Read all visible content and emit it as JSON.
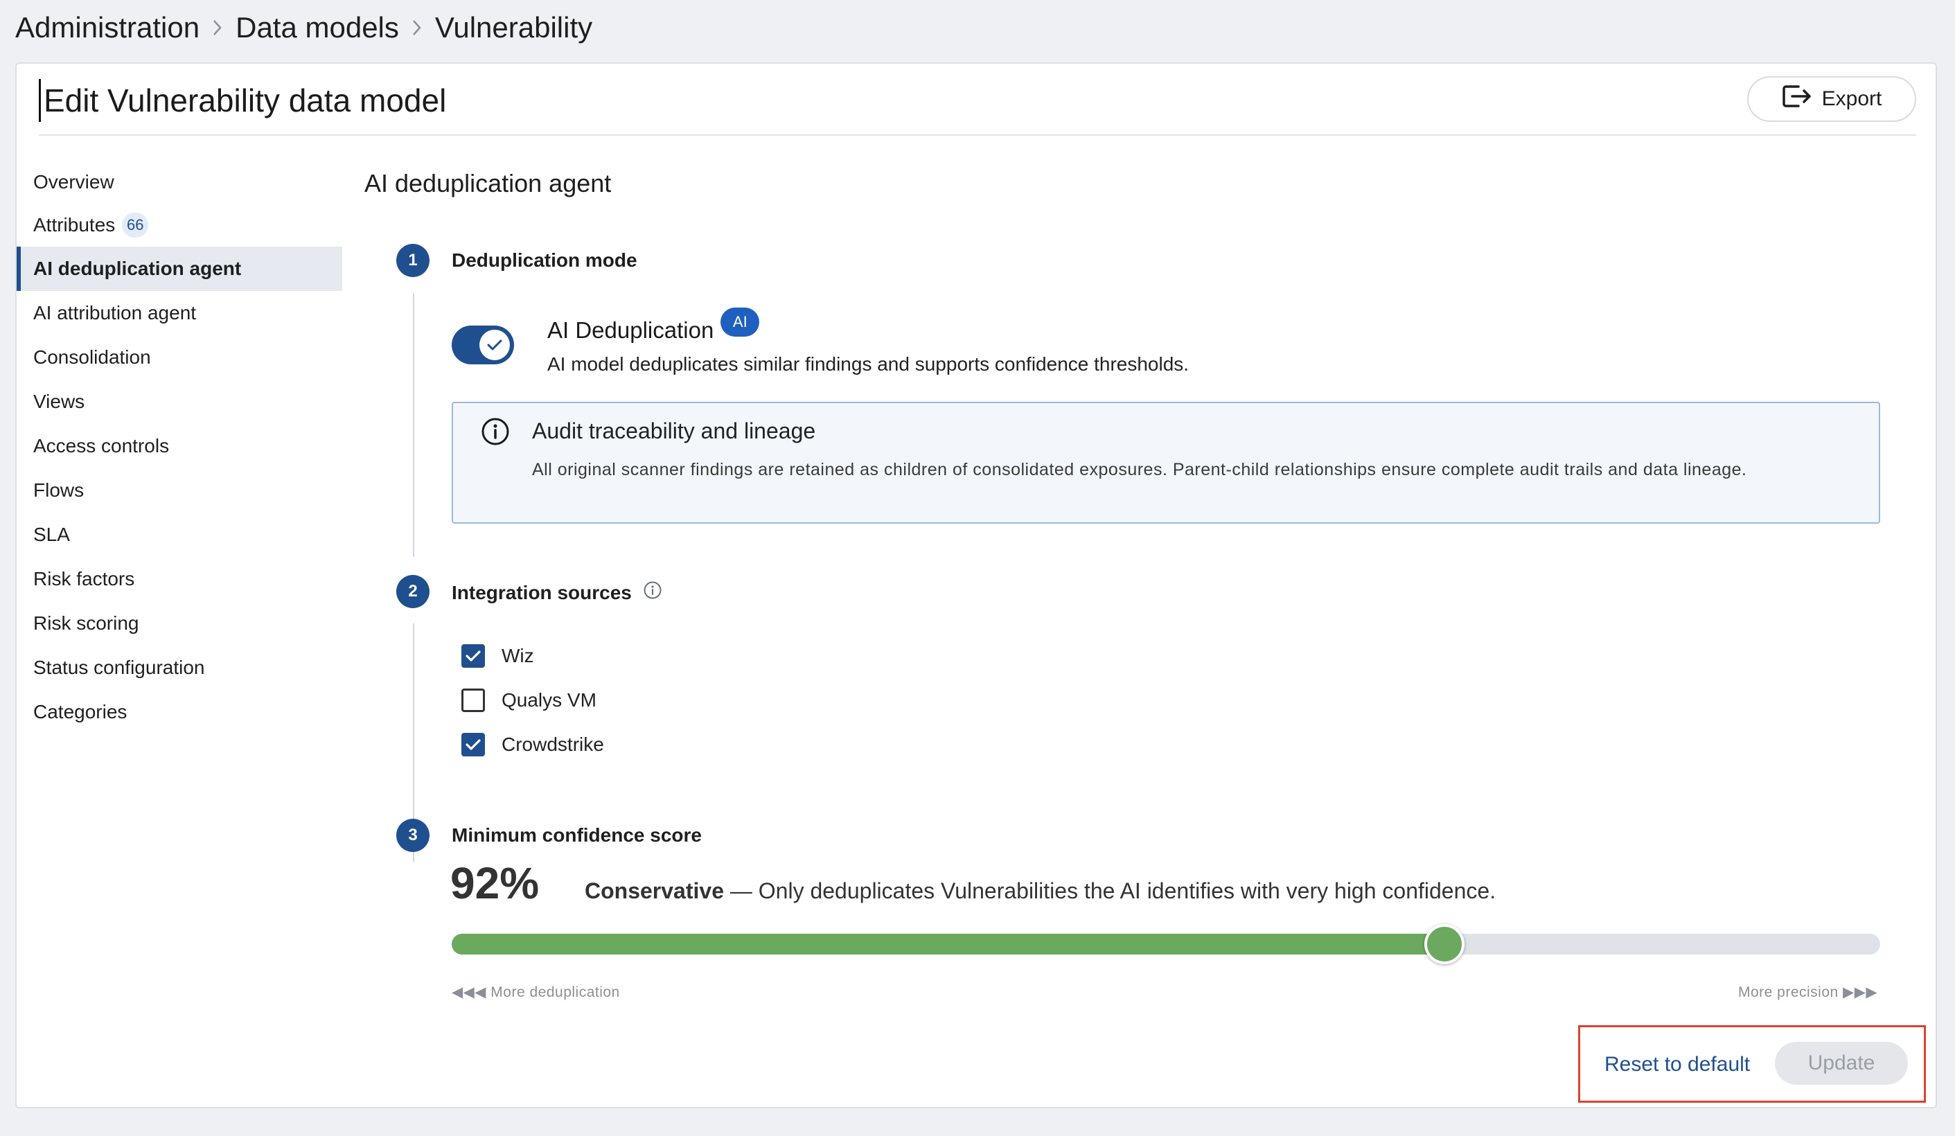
{
  "breadcrumb": [
    "Administration",
    "Data models",
    "Vulnerability"
  ],
  "header": {
    "title": "Edit Vulnerability data model",
    "export_label": "Export"
  },
  "sidebar": {
    "items": [
      {
        "label": "Overview"
      },
      {
        "label": "Attributes",
        "badge": "66"
      },
      {
        "label": "AI deduplication agent",
        "active": true
      },
      {
        "label": "AI attribution agent"
      },
      {
        "label": "Consolidation"
      },
      {
        "label": "Views"
      },
      {
        "label": "Access controls"
      },
      {
        "label": "Flows"
      },
      {
        "label": "SLA"
      },
      {
        "label": "Risk factors"
      },
      {
        "label": "Risk scoring"
      },
      {
        "label": "Status configuration"
      },
      {
        "label": "Categories"
      }
    ]
  },
  "main": {
    "section_title": "AI deduplication agent",
    "steps": [
      {
        "number": "1",
        "title": "Deduplication mode"
      },
      {
        "number": "2",
        "title": "Integration sources"
      },
      {
        "number": "3",
        "title": "Minimum confidence score"
      }
    ],
    "dedup": {
      "toggle_on": true,
      "title": "AI Deduplication",
      "badge": "AI",
      "description": "AI model deduplicates similar findings and supports confidence thresholds."
    },
    "info": {
      "title": "Audit traceability and lineage",
      "text": "All original scanner findings are retained as children of consolidated exposures. Parent-child relationships ensure complete audit trails and data lineage."
    },
    "sources": [
      {
        "label": "Wiz",
        "checked": true
      },
      {
        "label": "Qualys VM",
        "checked": false
      },
      {
        "label": "Crowdstrike",
        "checked": true
      }
    ],
    "confidence": {
      "value_label": "92%",
      "value": 92,
      "slider_fraction": 0.695,
      "mode": "Conservative",
      "mode_desc": " — Only deduplicates Vulnerabilities the AI identifies with very high confidence.",
      "left_hint": "More deduplication",
      "right_hint": "More precision"
    },
    "actions": {
      "reset_label": "Reset to default",
      "update_label": "Update"
    }
  },
  "colors": {
    "primary": "#1f4f8f",
    "slider": "#6aa95e",
    "highlight_border": "#e0402e"
  }
}
